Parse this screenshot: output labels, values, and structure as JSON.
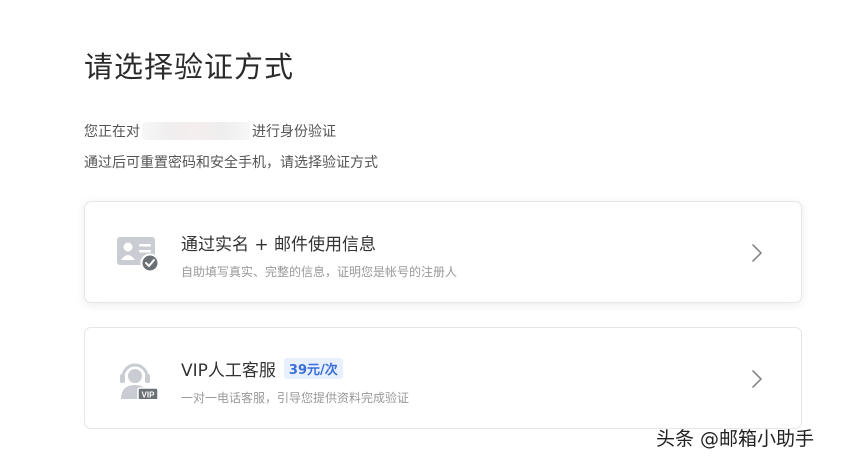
{
  "page": {
    "title": "请选择验证方式",
    "desc_prefix": "您正在对",
    "desc_suffix": "进行身份验证",
    "desc_line2": "通过后可重置密码和安全手机，请选择验证方式"
  },
  "options": [
    {
      "title": "通过实名 + 邮件使用信息",
      "subtitle": "自助填写真实、完整的信息，证明您是帐号的注册人",
      "icon": "id-card-check-icon"
    },
    {
      "title": "VIP人工客服",
      "badge": "39元/次",
      "subtitle": "一对一电话客服，引导您提供资料完成验证",
      "icon": "vip-agent-icon"
    }
  ],
  "watermark": "头条 @邮箱小助手",
  "colors": {
    "accent": "#3a6fd8",
    "badge_bg": "#e8effd",
    "icon_gray": "#c9ccd2",
    "icon_dark": "#6b6f76"
  }
}
